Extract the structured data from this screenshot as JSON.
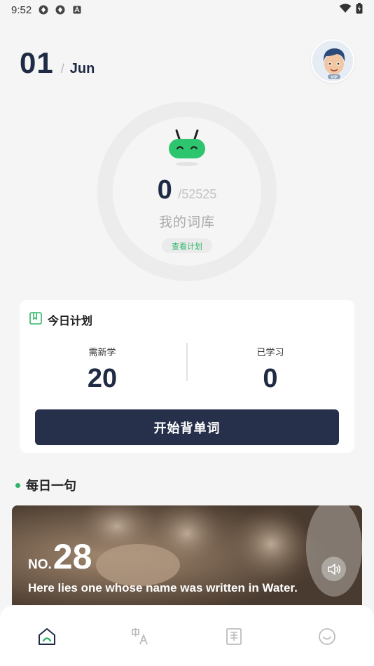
{
  "status_bar": {
    "time": "9:52",
    "icons": [
      "app-icon",
      "app-icon",
      "a-icon"
    ],
    "right_icons": [
      "wifi-icon",
      "battery-icon"
    ]
  },
  "header": {
    "day": "01",
    "separator": "/",
    "month": "Jun",
    "avatar_badge": "VIP"
  },
  "progress": {
    "learned": "0",
    "total": "/52525",
    "label": "我的词库",
    "plan_link": "查看计划"
  },
  "today_plan": {
    "title": "今日计划",
    "new_label": "需新学",
    "new_value": "20",
    "learned_label": "已学习",
    "learned_value": "0",
    "start_button": "开始背单词"
  },
  "daily_sentence": {
    "title": "每日一句",
    "no_prefix": "NO.",
    "number": "28",
    "sentence_en": "Here lies one whose name was written in Water."
  },
  "bottom_nav": [
    {
      "name": "home",
      "icon": "home-icon",
      "active": true
    },
    {
      "name": "translate",
      "icon": "translate-icon",
      "active": false
    },
    {
      "name": "wordbook",
      "icon": "book-icon",
      "active": false
    },
    {
      "name": "profile",
      "icon": "smile-icon",
      "active": false
    }
  ],
  "colors": {
    "accent": "#2eb56a",
    "primary_dark": "#27304a",
    "text_dark": "#1f2a44"
  }
}
